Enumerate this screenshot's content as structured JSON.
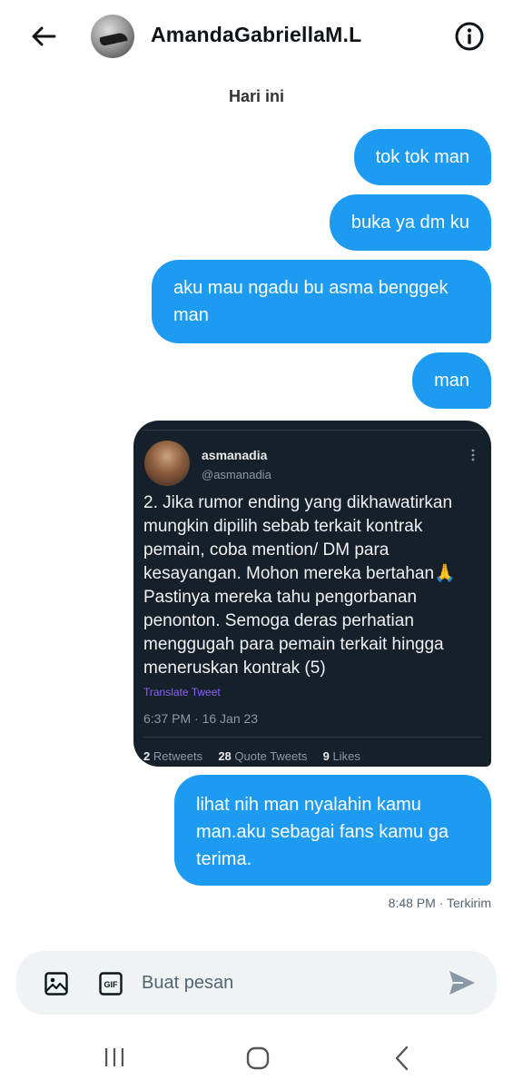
{
  "header": {
    "contact_name": "AmandaGabriellaM.L"
  },
  "day_label": "Hari ini",
  "messages": [
    {
      "text": "tok tok man"
    },
    {
      "text": "buka ya dm ku"
    },
    {
      "text": "aku mau ngadu bu asma benggek man"
    },
    {
      "text": "man"
    },
    {
      "text": "lihat nih man nyalahin kamu man.aku sebagai fans kamu ga terima."
    }
  ],
  "tweet": {
    "name": "asmanadia",
    "handle": "@asmanadia",
    "text": "2. Jika rumor ending yang dikhawatirkan mungkin dipilih sebab terkait kontrak pemain, coba mention/ DM para kesayangan. Mohon mereka bertahan🙏 Pastinya mereka tahu pengorbanan penonton. Semoga deras perhatian menggugah para pemain terkait hingga meneruskan kontrak (5)",
    "translate_label": "Translate Tweet",
    "timestamp": "6:37 PM · 16 Jan 23",
    "retweets_count": "2",
    "retweets_label": "Retweets",
    "quotes_count": "28",
    "quotes_label": "Quote Tweets",
    "likes_count": "9",
    "likes_label": "Likes"
  },
  "message_meta": "8:48 PM · Terkirim",
  "composer": {
    "placeholder": "Buat pesan"
  },
  "colors": {
    "bubble": "#1d9bf0",
    "tweet_bg": "#15202b",
    "translate": "#8d5ff5"
  },
  "icons": {
    "back": "arrow-left-icon",
    "info": "info-circle-icon",
    "media": "image-icon",
    "gif": "gif-icon",
    "send": "send-icon"
  }
}
